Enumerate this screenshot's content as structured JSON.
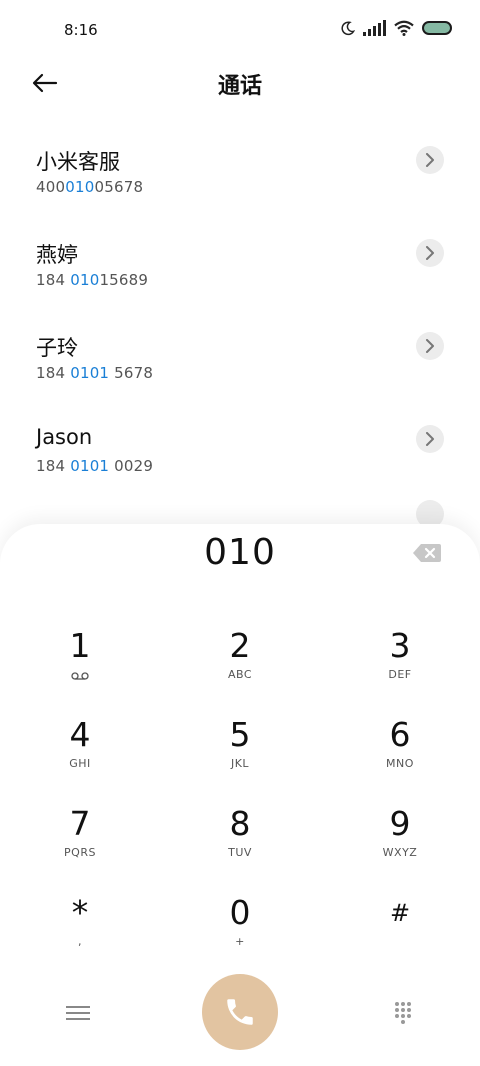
{
  "status": {
    "time": "8:16"
  },
  "header": {
    "title": "通话"
  },
  "contacts": [
    {
      "name": "小米客服",
      "number_parts": [
        "400",
        "010",
        "05678"
      ]
    },
    {
      "name": "燕婷",
      "number_parts": [
        "184 ",
        "010",
        "15689"
      ]
    },
    {
      "name": "子玲",
      "number_parts": [
        "184 ",
        "0101",
        " 5678"
      ]
    },
    {
      "name": "Jason",
      "number_parts": [
        "184 ",
        "0101",
        " 0029"
      ]
    }
  ],
  "dialpad": {
    "input": "010",
    "keys": [
      {
        "digit": "1",
        "letters": ""
      },
      {
        "digit": "2",
        "letters": "ABC"
      },
      {
        "digit": "3",
        "letters": "DEF"
      },
      {
        "digit": "4",
        "letters": "GHI"
      },
      {
        "digit": "5",
        "letters": "JKL"
      },
      {
        "digit": "6",
        "letters": "MNO"
      },
      {
        "digit": "7",
        "letters": "PQRS"
      },
      {
        "digit": "8",
        "letters": "TUV"
      },
      {
        "digit": "9",
        "letters": "WXYZ"
      },
      {
        "digit": "*",
        "letters": ","
      },
      {
        "digit": "0",
        "letters": "+"
      },
      {
        "digit": "#",
        "letters": ""
      }
    ]
  },
  "colors": {
    "highlight": "#1a7fd6",
    "call_button": "#e2c4a1",
    "battery_fill": "#85b9a3"
  },
  "icons": {
    "status": [
      "moon-icon",
      "signal-icon",
      "wifi-icon",
      "battery-icon"
    ],
    "header": "back-arrow-icon",
    "row_action": "chevron-right-icon",
    "dialpad": [
      "voicemail-icon",
      "backspace-icon",
      "menu-icon",
      "phone-icon",
      "dialpad-icon"
    ]
  }
}
